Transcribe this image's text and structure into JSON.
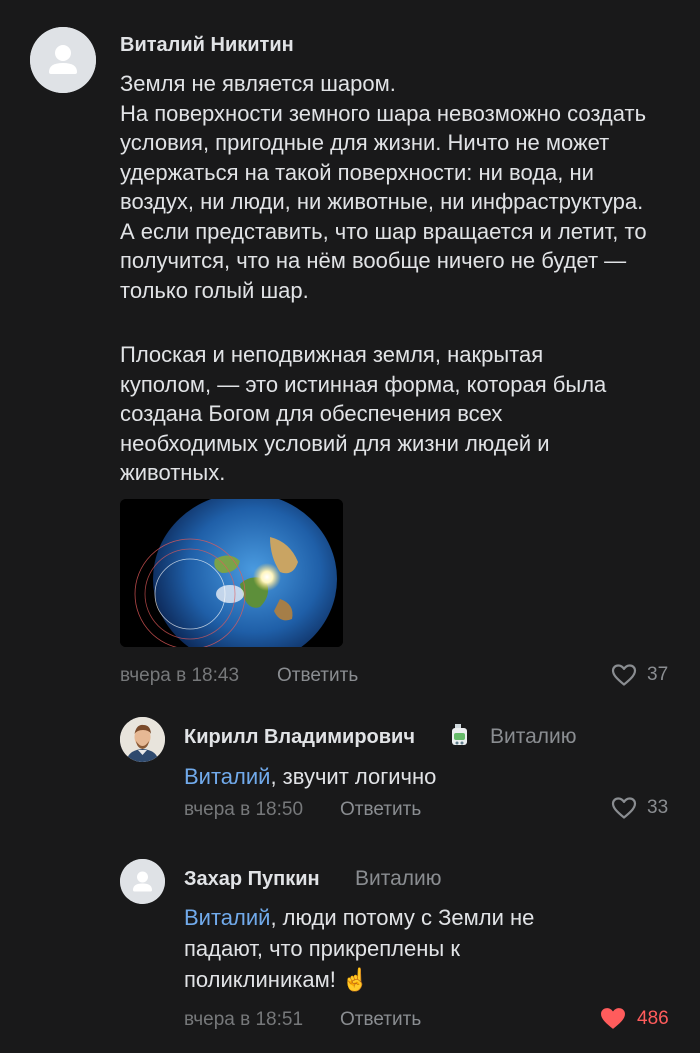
{
  "comment": {
    "author": "Виталий Никитин",
    "paragraph1": "Земля не является шаром.\nНа поверхности земного шара невозможно создать условия, пригодные для жизни. Ничто не может удержаться на такой поверхности: ни вода, ни воздух, ни люди, ни животные, ни инфраструктура. А если представить, что шар вращается и летит, то получится, что на нём вообще ничего не будет — только голый шар.",
    "paragraph2": "Плоская и неподвижная земля, накрытая куполом, — это истинная форма, которая была создана Богом для обеспечения всех необходимых условий для жизни людей и животных.",
    "time": "вчера в 18:43",
    "reply_label": "Ответить",
    "likes": "37"
  },
  "replies": [
    {
      "author": "Кирилл Владимирович",
      "reply_to": "Виталию",
      "mention": "Виталий",
      "text": ", звучит логично",
      "time": "вчера в 18:50",
      "reply_label": "Ответить",
      "likes": "33"
    },
    {
      "author": "Захар Пупкин",
      "reply_to": "Виталию",
      "mention": "Виталий",
      "text": ", люди потому с Земли не падают, что прикреплены к поликлиникам! ☝",
      "time": "вчера в 18:51",
      "reply_label": "Ответить",
      "likes": "486"
    }
  ],
  "colors": {
    "background": "#19191a",
    "mention": "#71aaeb",
    "liked": "#ff5c5c"
  },
  "icons": [
    "default-avatar-icon",
    "heart-outline-icon",
    "heart-filled-icon",
    "badge-icon"
  ]
}
